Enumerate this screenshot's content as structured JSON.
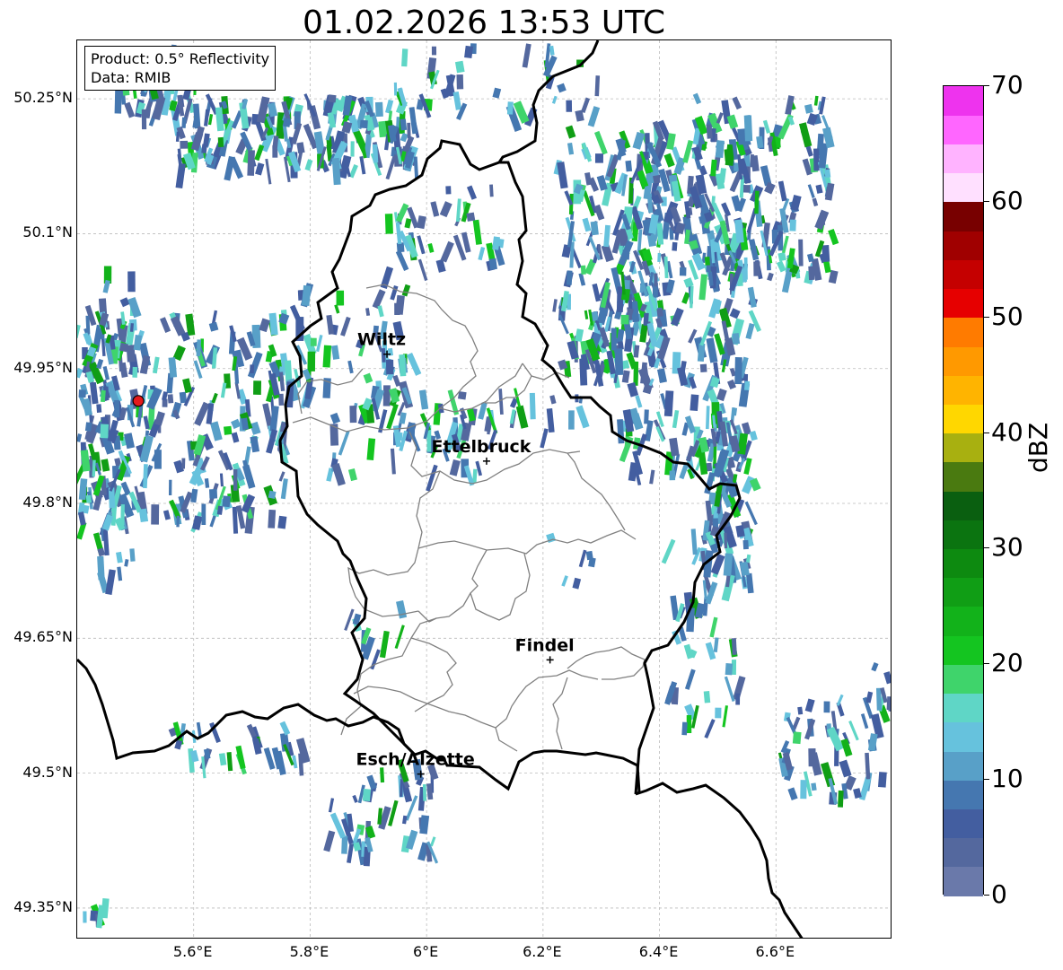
{
  "title": "01.02.2026 13:53 UTC",
  "info": {
    "product": "Product: 0.5° Reflectivity",
    "source": "Data: RMIB"
  },
  "map": {
    "lon_range": [
      5.4,
      6.8
    ],
    "lat_range": [
      49.315,
      50.315
    ],
    "lat_ticks": [
      {
        "value": 50.25,
        "label": "50.25°N"
      },
      {
        "value": 50.1,
        "label": "50.1°N"
      },
      {
        "value": 49.95,
        "label": "49.95°N"
      },
      {
        "value": 49.8,
        "label": "49.8°N"
      },
      {
        "value": 49.65,
        "label": "49.65°N"
      },
      {
        "value": 49.5,
        "label": "49.5°N"
      },
      {
        "value": 49.35,
        "label": "49.35°N"
      }
    ],
    "lon_ticks": [
      {
        "value": 5.6,
        "label": "5.6°E"
      },
      {
        "value": 5.8,
        "label": "5.8°E"
      },
      {
        "value": 6.0,
        "label": "6°E"
      },
      {
        "value": 6.2,
        "label": "6.2°E"
      },
      {
        "value": 6.4,
        "label": "6.4°E"
      },
      {
        "value": 6.6,
        "label": "6.6°E"
      }
    ],
    "grid": true,
    "radar_site": {
      "lon": 5.505,
      "lat": 49.914,
      "color": "#e41a1c"
    },
    "cities": [
      {
        "name": "Wiltz",
        "lon": 5.932,
        "lat": 49.966
      },
      {
        "name": "Ettelbruck",
        "lon": 6.103,
        "lat": 49.847
      },
      {
        "name": "Findel",
        "lon": 6.212,
        "lat": 49.626
      },
      {
        "name": "Esch/Alzette",
        "lon": 5.99,
        "lat": 49.499
      }
    ]
  },
  "colorbar": {
    "label": "dBZ",
    "min": 0,
    "max": 70,
    "ticks": [
      {
        "value": 0,
        "label": "0"
      },
      {
        "value": 10,
        "label": "10"
      },
      {
        "value": 20,
        "label": "20"
      },
      {
        "value": 30,
        "label": "30"
      },
      {
        "value": 40,
        "label": "40"
      },
      {
        "value": 50,
        "label": "50"
      },
      {
        "value": 60,
        "label": "60"
      },
      {
        "value": 70,
        "label": "70"
      }
    ],
    "colors": [
      "#6a79aa",
      "#54689e",
      "#435ea0",
      "#4577b0",
      "#58a0c8",
      "#66c2dd",
      "#5fd6c6",
      "#3fd46b",
      "#14c520",
      "#12b21a",
      "#109e15",
      "#0d8a10",
      "#0b7410",
      "#0a5f10",
      "#4a7a10",
      "#a8b010",
      "#ffd700",
      "#ffb400",
      "#ff9900",
      "#ff7b00",
      "#e60000",
      "#c50000",
      "#a00000",
      "#780000",
      "#ffe0ff",
      "#ffb3ff",
      "#ff66ff",
      "#ee33ee"
    ]
  }
}
